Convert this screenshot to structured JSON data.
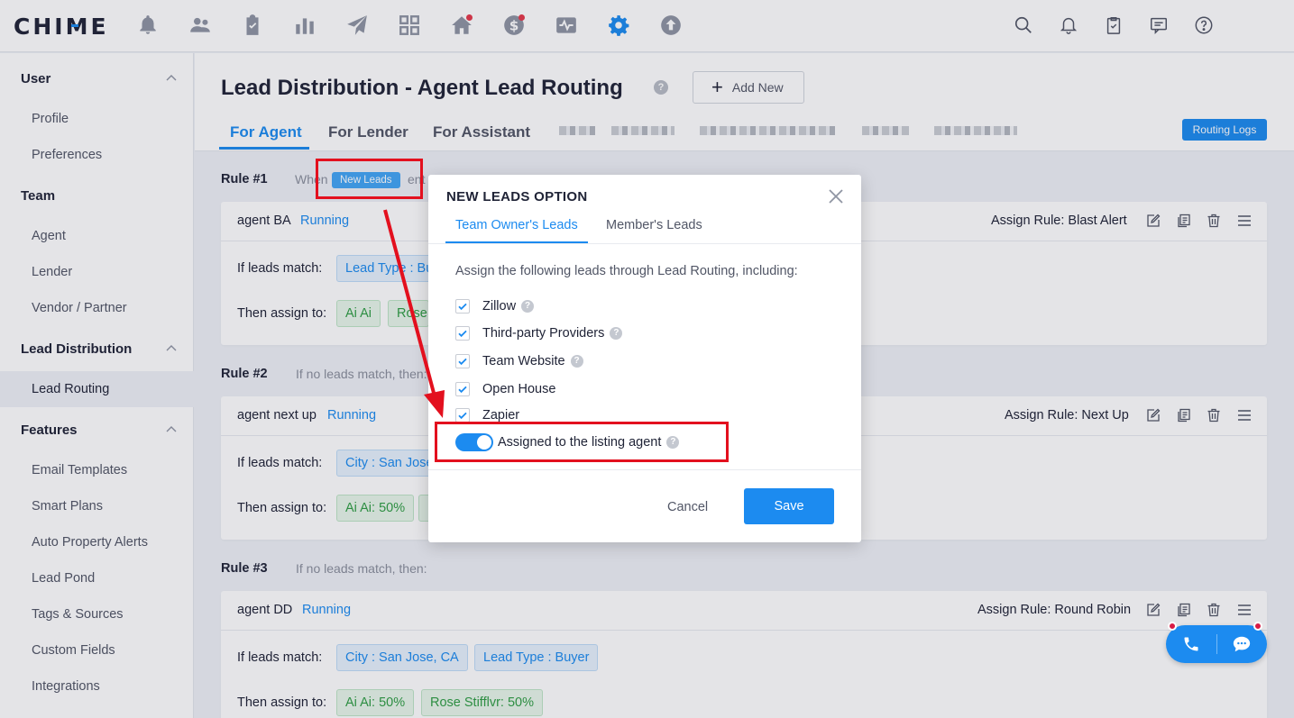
{
  "app": {
    "logo": "CHIME"
  },
  "sidebar": {
    "sections": [
      {
        "title": "User",
        "items": [
          "Profile",
          "Preferences"
        ]
      },
      {
        "title": "Team",
        "items": [
          "Agent",
          "Lender",
          "Vendor / Partner"
        ]
      },
      {
        "title": "Lead Distribution",
        "items": [
          "Lead Routing"
        ]
      },
      {
        "title": "Features",
        "items": [
          "Email Templates",
          "Smart Plans",
          "Auto Property Alerts",
          "Lead Pond",
          "Tags & Sources",
          "Custom Fields",
          "Integrations"
        ]
      }
    ],
    "active_item": "Lead Routing"
  },
  "header": {
    "title": "Lead Distribution - Agent Lead Routing",
    "help": "?",
    "add_new": "Add New",
    "tabs": [
      "For Agent",
      "For Lender",
      "For Assistant"
    ],
    "active_tab": "For Agent",
    "routing_logs": "Routing Logs"
  },
  "rules": [
    {
      "label": "Rule #1",
      "condition_prefix": "When",
      "condition_badge": "New Leads",
      "condition_suffix": "ent",
      "agent": "agent BA",
      "status": "Running",
      "assign_rule": "Assign Rule: Blast Alert",
      "match_label": "If leads match:",
      "match_chips": [
        "Lead Type : Bu"
      ],
      "assign_label": "Then assign to:",
      "assign_chips": [
        "Ai Ai",
        "Rose"
      ]
    },
    {
      "label": "Rule #2",
      "condition_prefix": "If no leads match, then:",
      "agent": "agent next up",
      "status": "Running",
      "assign_rule": "Assign Rule: Next Up",
      "match_label": "If leads match:",
      "match_chips": [
        "City : San Jose"
      ],
      "assign_label": "Then assign to:",
      "assign_chips": [
        "Ai Ai: 50%"
      ]
    },
    {
      "label": "Rule #3",
      "condition_prefix": "If no leads match, then:",
      "agent": "agent DD",
      "status": "Running",
      "assign_rule": "Assign Rule: Round Robin",
      "match_label": "If leads match:",
      "match_chips": [
        "City : San Jose, CA",
        "Lead Type : Buyer"
      ],
      "assign_label": "Then assign to:",
      "assign_chips": [
        "Ai Ai: 50%",
        "Rose Stifflvr: 50%"
      ]
    }
  ],
  "modal": {
    "title": "NEW LEADS OPTION",
    "tabs": [
      "Team Owner's Leads",
      "Member's Leads"
    ],
    "active_tab": "Team Owner's Leads",
    "description": "Assign the following leads through Lead Routing, including:",
    "options": [
      {
        "label": "Zillow",
        "checked": true,
        "help": true
      },
      {
        "label": "Third-party Providers",
        "checked": true,
        "help": true
      },
      {
        "label": "Team Website",
        "checked": true,
        "help": true
      },
      {
        "label": "Open House",
        "checked": true,
        "help": false
      },
      {
        "label": "Zapier",
        "checked": true,
        "help": false
      }
    ],
    "toggle": {
      "label": "Assigned to the listing agent",
      "on": true
    },
    "cancel": "Cancel",
    "save": "Save"
  },
  "colors": {
    "accent": "#1c8bf0",
    "annotation_red": "#e3101e",
    "chip_green_text": "#2f9e44"
  },
  "icons": {
    "top_nav": [
      "bell-alert-icon",
      "people-icon",
      "clipboard-icon",
      "bar-chart-icon",
      "paper-plane-icon",
      "grid-icon",
      "home-icon",
      "dollar-icon",
      "activity-icon",
      "gear-icon",
      "upload-icon"
    ],
    "top_right": [
      "search-icon",
      "notification-bell-icon",
      "task-icon",
      "message-icon",
      "help-icon"
    ],
    "card_actions": [
      "edit-icon",
      "copy-icon",
      "delete-icon",
      "drag-handle-icon"
    ],
    "float": [
      "phone-icon",
      "chat-icon"
    ]
  }
}
